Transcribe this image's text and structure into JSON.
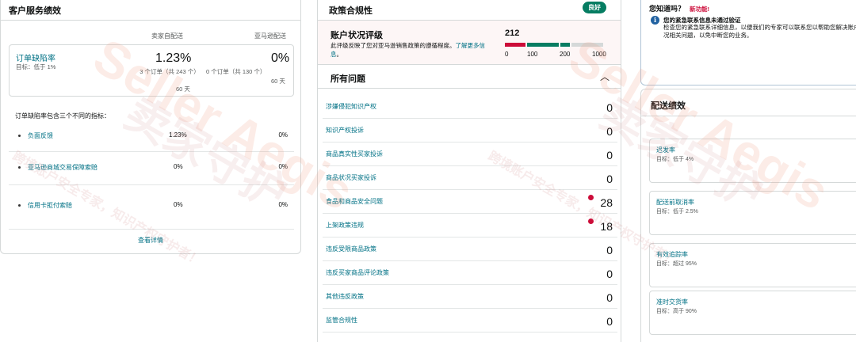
{
  "customer_service": {
    "title": "客户服务绩效",
    "col_seller": "卖家自配送",
    "col_amazon": "亚马逊配送",
    "odr": {
      "label": "订单缺陷率",
      "target": "目标：低于 1%",
      "seller_pct": "1.23%",
      "seller_orders": "3 个订单（共 243 个）",
      "seller_days": "60 天",
      "amazon_pct": "0%",
      "amazon_orders": "0 个订单（共 130 个）",
      "amazon_days": "60 天"
    },
    "includes_text": "订单缺陷率包含三个不同的指标：",
    "metrics": [
      {
        "name": "负面反馈",
        "seller": "1.23%",
        "amazon": "0%"
      },
      {
        "name": "亚马逊商城交易保障索赔",
        "seller": "0%",
        "amazon": "0%"
      },
      {
        "name": "信用卡拒付索赔",
        "seller": "0%",
        "amazon": "0%"
      }
    ],
    "view_details": "查看详情"
  },
  "policy": {
    "title": "政策合规性",
    "badge": "良好",
    "ahr_title": "账户状况评级",
    "ahr_desc": "此评级反映了您对亚马逊销售政策的遵循程度。",
    "ahr_learn": "了解更多信息",
    "ahr_score": "212",
    "ahr_scale": [
      "0",
      "100",
      "200",
      "1000"
    ],
    "ahr_segments": [
      "#cc0c39",
      "#067d62",
      "#067d62",
      "#d5d9d9"
    ],
    "issues_title": "所有问题",
    "issues": [
      {
        "name": "涉嫌侵犯知识产权",
        "count": "0",
        "alert": false
      },
      {
        "name": "知识产权投诉",
        "count": "0",
        "alert": false
      },
      {
        "name": "商品真实性买家投诉",
        "count": "0",
        "alert": false
      },
      {
        "name": "商品状况买家投诉",
        "count": "0",
        "alert": false
      },
      {
        "name": "食品和商品安全问题",
        "count": "28",
        "alert": true
      },
      {
        "name": "上架政策违规",
        "count": "18",
        "alert": true
      },
      {
        "name": "违反受限商品政策",
        "count": "0",
        "alert": false
      },
      {
        "name": "违反买家商品评论政策",
        "count": "0",
        "alert": false
      },
      {
        "name": "其他违反政策",
        "count": "0",
        "alert": false
      },
      {
        "name": "监管合规性",
        "count": "0",
        "alert": false
      }
    ]
  },
  "did_you_know": {
    "title": "您知道吗？",
    "new_feature": "新功能!",
    "headline": "您的紧急联系信息未通过验证",
    "body": "检查您的紧急联系详细信息，以便我们的专家可以联系您以帮助您解决账户状况相关问题，以免中断您的业务。"
  },
  "shipping": {
    "title": "配送绩效",
    "metrics": [
      {
        "name": "迟发率",
        "target": "目标：低于 4%"
      },
      {
        "name": "配送前取消率",
        "target": "目标：低于 2.5%"
      },
      {
        "name": "有效追踪率",
        "target": "目标：超过 95%"
      },
      {
        "name": "准时交货率",
        "target": "目标：高于 90%"
      }
    ]
  },
  "watermark": {
    "brand_en": "Seller Aegis",
    "brand_cn": "卖家守护",
    "slogan": "跨境账户安全专家，知识产权守护者！"
  }
}
